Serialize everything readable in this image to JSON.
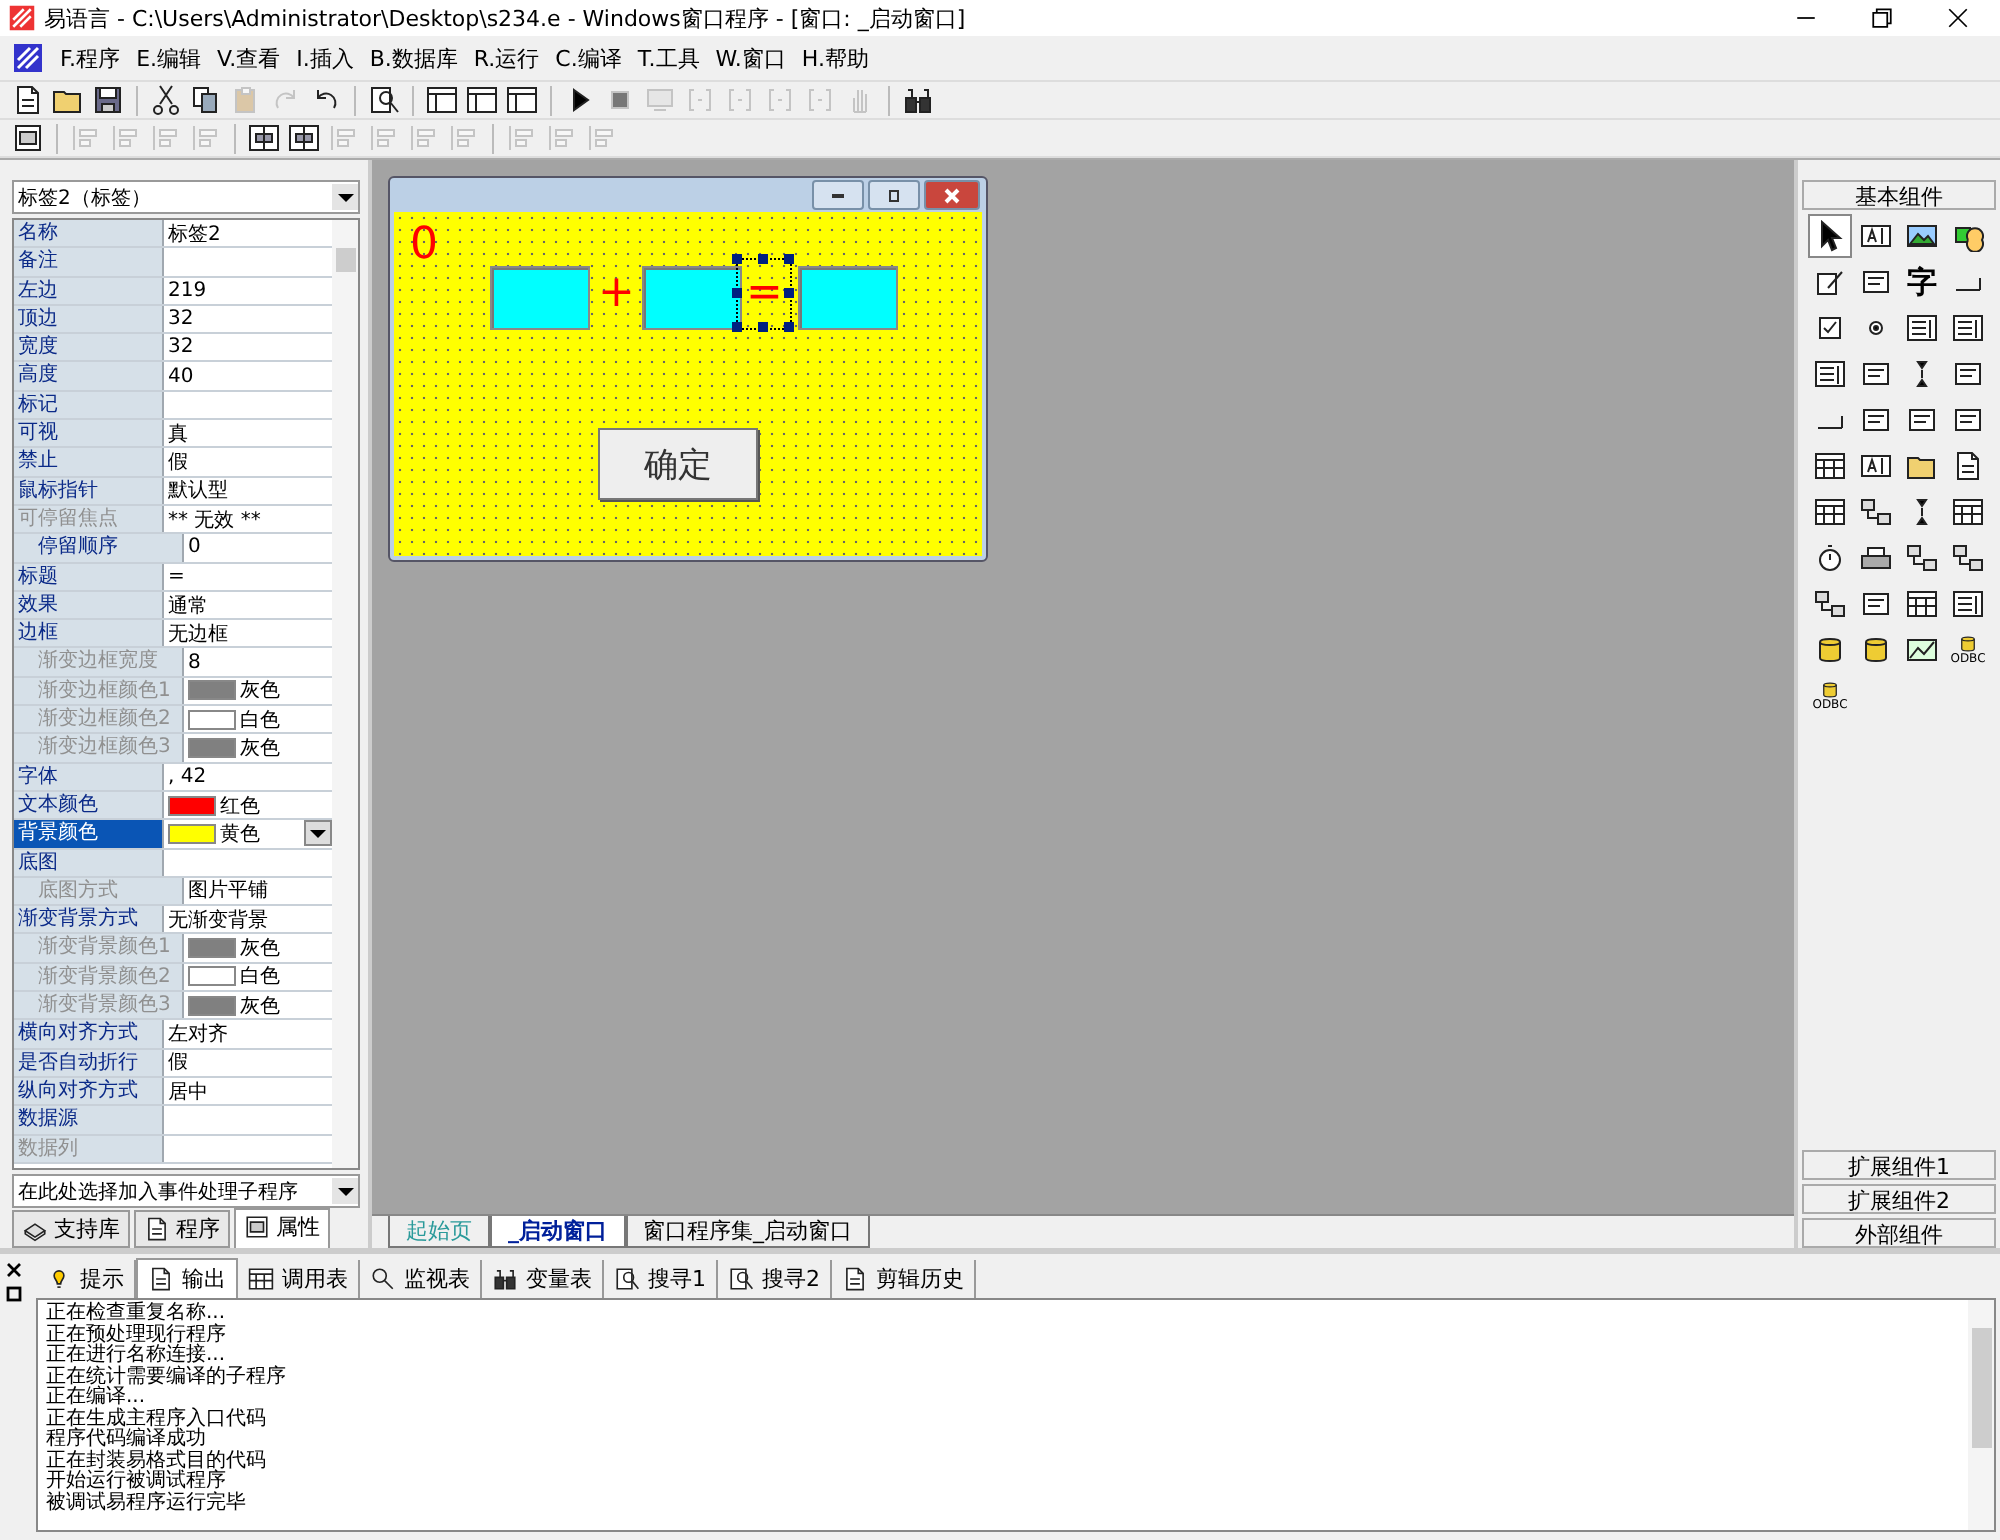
{
  "window": {
    "title": "易语言 - C:\\Users\\Administrator\\Desktop\\s234.e - Windows窗口程序 - [窗口: _启动窗口]"
  },
  "menu": [
    "F.程序",
    "E.编辑",
    "V.查看",
    "I.插入",
    "B.数据库",
    "R.运行",
    "C.编译",
    "T.工具",
    "W.窗口",
    "H.帮助"
  ],
  "toolbar": [
    {
      "kind": "page",
      "disabled": false
    },
    {
      "kind": "folder",
      "disabled": false
    },
    {
      "kind": "disk",
      "disabled": false
    },
    {
      "kind": "sep"
    },
    {
      "kind": "scissors",
      "disabled": false
    },
    {
      "kind": "copy",
      "disabled": false
    },
    {
      "kind": "paste",
      "disabled": true
    },
    {
      "kind": "redo",
      "disabled": true
    },
    {
      "kind": "undo",
      "disabled": false
    },
    {
      "kind": "sep"
    },
    {
      "kind": "find",
      "disabled": false
    },
    {
      "kind": "sep"
    },
    {
      "kind": "layout",
      "disabled": false
    },
    {
      "kind": "layout",
      "disabled": false
    },
    {
      "kind": "layout",
      "disabled": false
    },
    {
      "kind": "sep"
    },
    {
      "kind": "play",
      "disabled": false
    },
    {
      "kind": "stop",
      "disabled": true
    },
    {
      "kind": "screen",
      "disabled": true
    },
    {
      "kind": "braces",
      "disabled": true
    },
    {
      "kind": "braces",
      "disabled": true
    },
    {
      "kind": "braces",
      "disabled": true
    },
    {
      "kind": "braces",
      "disabled": true
    },
    {
      "kind": "hand",
      "disabled": true
    },
    {
      "kind": "sep"
    },
    {
      "kind": "binoculars",
      "disabled": false
    }
  ],
  "align_toolbar": [
    {
      "kind": "form",
      "disabled": false
    },
    {
      "kind": "sep"
    },
    {
      "kind": "align",
      "disabled": true
    },
    {
      "kind": "align",
      "disabled": true
    },
    {
      "kind": "align",
      "disabled": true
    },
    {
      "kind": "align",
      "disabled": true
    },
    {
      "kind": "sep"
    },
    {
      "kind": "center",
      "disabled": false
    },
    {
      "kind": "center",
      "disabled": false
    },
    {
      "kind": "align",
      "disabled": true
    },
    {
      "kind": "align",
      "disabled": true
    },
    {
      "kind": "align",
      "disabled": true
    },
    {
      "kind": "align",
      "disabled": true
    },
    {
      "kind": "sep"
    },
    {
      "kind": "align",
      "disabled": true
    },
    {
      "kind": "align",
      "disabled": true
    },
    {
      "kind": "align",
      "disabled": true
    }
  ],
  "properties": {
    "object": "标签2（标签）",
    "rows": [
      {
        "name": "名称",
        "value": "标签2",
        "indent": false,
        "disabled": false,
        "selected": false
      },
      {
        "name": "备注",
        "value": "",
        "indent": false,
        "disabled": false,
        "selected": false
      },
      {
        "name": "左边",
        "value": "219",
        "indent": false,
        "disabled": false,
        "selected": false
      },
      {
        "name": "顶边",
        "value": "32",
        "indent": false,
        "disabled": false,
        "selected": false
      },
      {
        "name": "宽度",
        "value": "32",
        "indent": false,
        "disabled": false,
        "selected": false
      },
      {
        "name": "高度",
        "value": "40",
        "indent": false,
        "disabled": false,
        "selected": false
      },
      {
        "name": "标记",
        "value": "",
        "indent": false,
        "disabled": false,
        "selected": false
      },
      {
        "name": "可视",
        "value": "真",
        "indent": false,
        "disabled": false,
        "selected": false
      },
      {
        "name": "禁止",
        "value": "假",
        "indent": false,
        "disabled": false,
        "selected": false
      },
      {
        "name": "鼠标指针",
        "value": "默认型",
        "indent": false,
        "disabled": false,
        "selected": false
      },
      {
        "name": "可停留焦点",
        "value": "** 无效 **",
        "indent": false,
        "disabled": true,
        "selected": false
      },
      {
        "name": "停留顺序",
        "value": "0",
        "indent": true,
        "disabled": false,
        "selected": false
      },
      {
        "name": "标题",
        "value": "=",
        "indent": false,
        "disabled": false,
        "selected": false
      },
      {
        "name": "效果",
        "value": "通常",
        "indent": false,
        "disabled": false,
        "selected": false
      },
      {
        "name": "边框",
        "value": "无边框",
        "indent": false,
        "disabled": false,
        "selected": false
      },
      {
        "name": "渐变边框宽度",
        "value": "8",
        "indent": true,
        "disabled": true,
        "selected": false
      },
      {
        "name": "渐变边框颜色1",
        "value": "灰色",
        "color": "#808080",
        "indent": true,
        "disabled": true,
        "selected": false
      },
      {
        "name": "渐变边框颜色2",
        "value": "白色",
        "color": "#ffffff",
        "indent": true,
        "disabled": true,
        "selected": false
      },
      {
        "name": "渐变边框颜色3",
        "value": "灰色",
        "color": "#808080",
        "indent": true,
        "disabled": true,
        "selected": false
      },
      {
        "name": "字体",
        "value": ", 42",
        "indent": false,
        "disabled": false,
        "selected": false
      },
      {
        "name": "文本颜色",
        "value": "红色",
        "color": "#ff0000",
        "indent": false,
        "disabled": false,
        "selected": false
      },
      {
        "name": "背景颜色",
        "value": "黄色",
        "color": "#ffff00",
        "indent": false,
        "disabled": false,
        "selected": true
      },
      {
        "name": "底图",
        "value": "",
        "indent": false,
        "disabled": false,
        "selected": false
      },
      {
        "name": "底图方式",
        "value": "图片平铺",
        "indent": true,
        "disabled": true,
        "selected": false
      },
      {
        "name": "渐变背景方式",
        "value": "无渐变背景",
        "indent": false,
        "disabled": false,
        "selected": false
      },
      {
        "name": "渐变背景颜色1",
        "value": "灰色",
        "color": "#808080",
        "indent": true,
        "disabled": true,
        "selected": false
      },
      {
        "name": "渐变背景颜色2",
        "value": "白色",
        "color": "#ffffff",
        "indent": true,
        "disabled": true,
        "selected": false
      },
      {
        "name": "渐变背景颜色3",
        "value": "灰色",
        "color": "#808080",
        "indent": true,
        "disabled": true,
        "selected": false
      },
      {
        "name": "横向对齐方式",
        "value": "左对齐",
        "indent": false,
        "disabled": false,
        "selected": false
      },
      {
        "name": "是否自动折行",
        "value": "假",
        "indent": false,
        "disabled": false,
        "selected": false
      },
      {
        "name": "纵向对齐方式",
        "value": "居中",
        "indent": false,
        "disabled": false,
        "selected": false
      },
      {
        "name": "数据源",
        "value": "",
        "indent": false,
        "disabled": false,
        "selected": false
      },
      {
        "name": "数据列",
        "value": "",
        "indent": false,
        "disabled": true,
        "selected": false
      }
    ],
    "event_picker": "在此处选择加入事件处理子程序",
    "tabs": [
      {
        "label": "支持库",
        "kind": "books",
        "selected": false
      },
      {
        "label": "程序",
        "kind": "page",
        "selected": false
      },
      {
        "label": "属性",
        "kind": "form",
        "selected": true
      }
    ]
  },
  "designer": {
    "controls": [
      {
        "kind": "label",
        "text": "0",
        "selected": false
      },
      {
        "kind": "edit",
        "selected": false
      },
      {
        "kind": "label",
        "text": "+",
        "selected": false
      },
      {
        "kind": "edit",
        "selected": false
      },
      {
        "kind": "label",
        "text": "=",
        "selected": true
      },
      {
        "kind": "edit",
        "selected": false
      },
      {
        "kind": "button",
        "text": "确定",
        "selected": false
      }
    ]
  },
  "doc_tabs": [
    {
      "label": "起始页",
      "selected": false
    },
    {
      "label": "_启动窗口",
      "selected": true
    },
    {
      "label": "窗口程序集_启动窗口",
      "selected": false
    }
  ],
  "toolbox": {
    "header": "基本组件",
    "items": [
      {
        "kind": "pointer",
        "selected": true
      },
      {
        "kind": "textbox",
        "selected": false
      },
      {
        "kind": "picture",
        "selected": false
      },
      {
        "kind": "shapes",
        "selected": false
      },
      {
        "kind": "pen",
        "selected": false
      },
      {
        "kind": "widget",
        "selected": false
      },
      {
        "kind": "char",
        "text": "字",
        "selected": false
      },
      {
        "kind": "line",
        "selected": false
      },
      {
        "kind": "checkbox",
        "selected": false
      },
      {
        "kind": "radio",
        "selected": false
      },
      {
        "kind": "list",
        "selected": false
      },
      {
        "kind": "list",
        "selected": false
      },
      {
        "kind": "list",
        "selected": false
      },
      {
        "kind": "widget",
        "selected": false
      },
      {
        "kind": "spinner",
        "selected": false
      },
      {
        "kind": "widget",
        "selected": false
      },
      {
        "kind": "line",
        "selected": false
      },
      {
        "kind": "widget",
        "selected": false
      },
      {
        "kind": "widget",
        "selected": false
      },
      {
        "kind": "widget",
        "selected": false
      },
      {
        "kind": "grid",
        "selected": false
      },
      {
        "kind": "textbox",
        "selected": false
      },
      {
        "kind": "folder",
        "selected": false
      },
      {
        "kind": "page",
        "selected": false
      },
      {
        "kind": "grid",
        "selected": false
      },
      {
        "kind": "network",
        "selected": false
      },
      {
        "kind": "spinner",
        "selected": false
      },
      {
        "kind": "grid",
        "selected": false
      },
      {
        "kind": "timer",
        "selected": false
      },
      {
        "kind": "printer",
        "selected": false
      },
      {
        "kind": "network",
        "selected": false
      },
      {
        "kind": "network",
        "selected": false
      },
      {
        "kind": "network",
        "selected": false
      },
      {
        "kind": "widget",
        "selected": false
      },
      {
        "kind": "grid",
        "selected": false
      },
      {
        "kind": "list",
        "selected": false
      },
      {
        "kind": "db",
        "selected": false
      },
      {
        "kind": "db",
        "selected": false
      },
      {
        "kind": "chart",
        "selected": false
      },
      {
        "kind": "odbc",
        "text": "ODBC",
        "selected": false
      },
      {
        "kind": "odbc",
        "text": "ODBC",
        "selected": false
      }
    ],
    "footer": [
      "扩展组件1",
      "扩展组件2",
      "外部组件"
    ]
  },
  "output": {
    "tabs": [
      {
        "label": "提示",
        "kind": "bulb",
        "selected": false
      },
      {
        "label": "输出",
        "kind": "page",
        "selected": true
      },
      {
        "label": "调用表",
        "kind": "grid",
        "selected": false
      },
      {
        "label": "监视表",
        "kind": "magnifier",
        "selected": false
      },
      {
        "label": "变量表",
        "kind": "binoculars",
        "selected": false
      },
      {
        "label": "搜寻1",
        "kind": "find",
        "selected": false
      },
      {
        "label": "搜寻2",
        "kind": "find",
        "selected": false
      },
      {
        "label": "剪辑历史",
        "kind": "page",
        "selected": false
      }
    ],
    "lines": [
      "正在检查重复名称...",
      "正在预处理现行程序",
      "正在进行名称连接...",
      "正在统计需要编译的子程序",
      "正在编译...",
      "正在生成主程序入口代码",
      "程序代码编译成功",
      "正在封装易格式目的代码",
      "开始运行被调试程序",
      "被调试易程序运行完毕"
    ]
  }
}
